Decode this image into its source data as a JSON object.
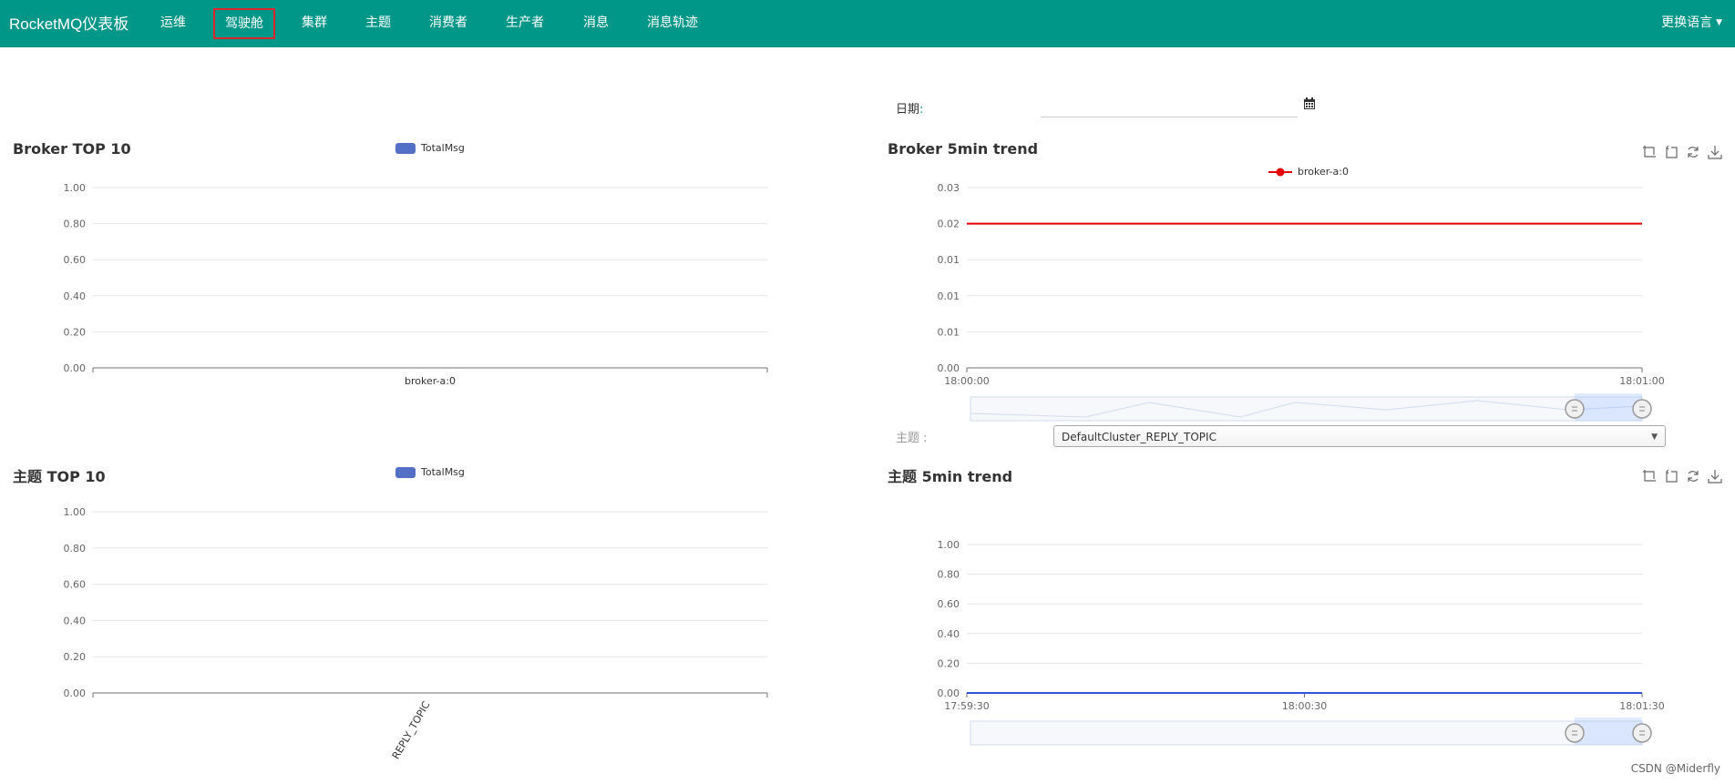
{
  "nav": {
    "brand": "RocketMQ仪表板",
    "items": [
      {
        "label": "运维",
        "active": false
      },
      {
        "label": "驾驶舱",
        "active": true
      },
      {
        "label": "集群",
        "active": false
      },
      {
        "label": "主题",
        "active": false
      },
      {
        "label": "消费者",
        "active": false
      },
      {
        "label": "生产者",
        "active": false
      },
      {
        "label": "消息",
        "active": false
      },
      {
        "label": "消息轨迹",
        "active": false
      }
    ],
    "language": "更换语言"
  },
  "date_filter": {
    "label": "日期",
    "colon": ":",
    "value": ""
  },
  "topic_filter": {
    "label": "主题",
    "colon": ":",
    "selected": "DefaultCluster_REPLY_TOPIC"
  },
  "icons": {
    "calendar": "calendar-icon",
    "toolbox": [
      "zoom-icon",
      "zoom-reset-icon",
      "restore-icon",
      "save-image-icon"
    ]
  },
  "watermark": "CSDN @Miderfly",
  "colors": {
    "nav": "#009688",
    "bar": "#5470c6",
    "broker_line": "#e50000",
    "topic_line": "#3355dd"
  },
  "chart_data": [
    {
      "type": "bar",
      "title": "Broker TOP 10",
      "categories": [
        "broker-a:0"
      ],
      "series": [
        {
          "name": "TotalMsg",
          "values": [
            0
          ]
        }
      ],
      "yticks": [
        "0.00",
        "0.20",
        "0.40",
        "0.60",
        "0.80",
        "1.00"
      ],
      "ylim": [
        0,
        1
      ]
    },
    {
      "type": "line",
      "title": "Broker 5min trend",
      "x": [
        "18:00:00",
        "18:01:00"
      ],
      "series": [
        {
          "name": "broker-a:0",
          "values": [
            0.024,
            0.024
          ]
        }
      ],
      "yticks": [
        "0.00",
        "0.01",
        "0.01",
        "0.01",
        "0.02",
        "0.03"
      ],
      "ylim": [
        0,
        0.03
      ],
      "legend": "top-center"
    },
    {
      "type": "bar",
      "title": "主题 TOP 10",
      "categories": [
        "REPLY_TOPIC"
      ],
      "series": [
        {
          "name": "TotalMsg",
          "values": [
            0
          ]
        }
      ],
      "yticks": [
        "0.00",
        "0.20",
        "0.40",
        "0.60",
        "0.80",
        "1.00"
      ],
      "ylim": [
        0,
        1
      ]
    },
    {
      "type": "line",
      "title": "主题 5min trend",
      "x": [
        "17:59:30",
        "18:00:30",
        "18:01:30"
      ],
      "series": [
        {
          "values": [
            0,
            0,
            0
          ]
        }
      ],
      "yticks": [
        "0.00",
        "0.20",
        "0.40",
        "0.60",
        "0.80",
        "1.00"
      ],
      "ylim": [
        0,
        1
      ]
    }
  ]
}
